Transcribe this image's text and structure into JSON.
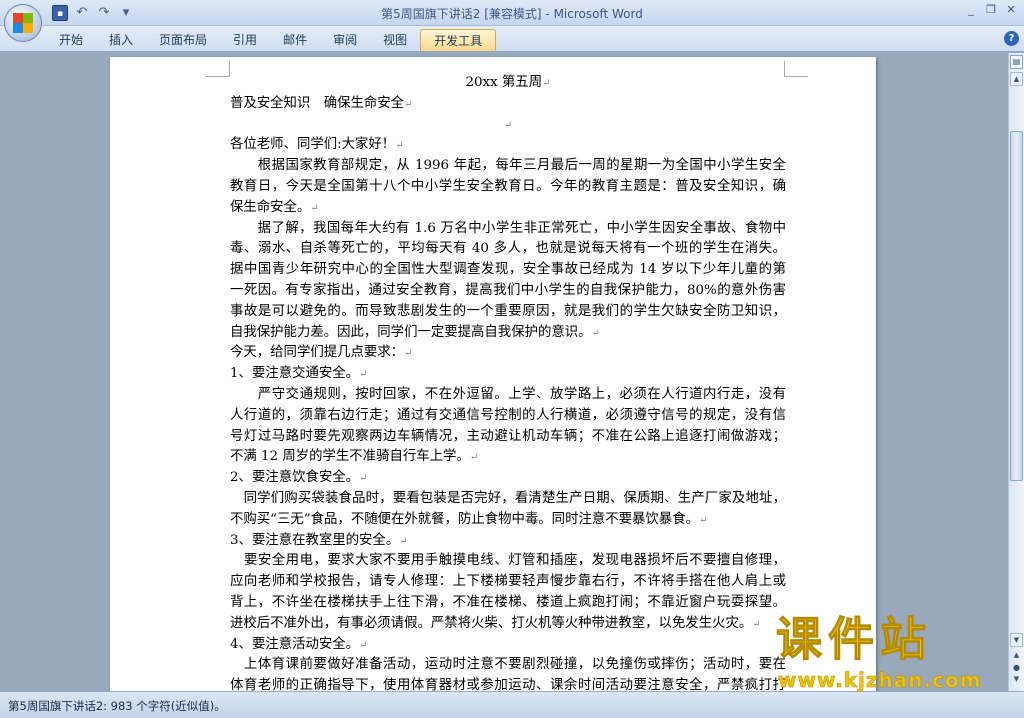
{
  "window": {
    "title": "第5周国旗下讲话2 [兼容模式]",
    "app_name": "Microsoft Word",
    "controls": [
      "_",
      "❐",
      "✕"
    ]
  },
  "qat": {
    "save": "▪",
    "undo": "↶",
    "redo": "↷",
    "more": "▾"
  },
  "ribbon": {
    "tabs": [
      {
        "label": "开始"
      },
      {
        "label": "插入"
      },
      {
        "label": "页面布局"
      },
      {
        "label": "引用"
      },
      {
        "label": "邮件"
      },
      {
        "label": "审阅"
      },
      {
        "label": "视图"
      },
      {
        "label": "开发工具"
      }
    ],
    "help": "?"
  },
  "document": {
    "lines": [
      {
        "text": "20xx 第五周",
        "align": "center"
      },
      {
        "text": "普及安全知识　确保生命安全",
        "align": "left"
      },
      {
        "text": "",
        "align": "center"
      },
      {
        "text": "各位老师、同学们:大家好！",
        "align": "left"
      },
      {
        "text": "　　根据国家教育部规定，从 1996 年起，每年三月最后一周的星期一为全国中小学生安全",
        "align": "just"
      },
      {
        "text": "教育日，今天是全国第十八个中小学生安全教育日。今年的教育主题是：普及安全知识，确",
        "align": "just"
      },
      {
        "text": "保生命安全。",
        "align": "left"
      },
      {
        "text": "　　据了解，我国每年大约有 1.6 万名中小学生非正常死亡，中小学生因安全事故、食物中",
        "align": "just"
      },
      {
        "text": "毒、溺水、自杀等死亡的，平均每天有 40 多人，也就是说每天将有一个班的学生在消失。",
        "align": "just"
      },
      {
        "text": "据中国青少年研究中心的全国性大型调查发现，安全事故已经成为 14 岁以下少年儿童的第",
        "align": "just"
      },
      {
        "text": "一死因。有专家指出，通过安全教育，提高我们中小学生的自我保护能力，80%的意外伤害",
        "align": "just"
      },
      {
        "text": "事故是可以避免的。而导致悲剧发生的一个重要原因，就是我们的学生欠缺安全防卫知识，",
        "align": "just"
      },
      {
        "text": "自我保护能力差。因此，同学们一定要提高自我保护的意识。",
        "align": "left"
      },
      {
        "text": "今天，给同学们提几点要求：",
        "align": "left"
      },
      {
        "text": "1、要注意交通安全。",
        "align": "left"
      },
      {
        "text": "　　严守交通规则，按时回家，不在外逗留。上学、放学路上，必须在人行道内行走，没有",
        "align": "just"
      },
      {
        "text": "人行道的，须靠右边行走；通过有交通信号控制的人行横道，必须遵守信号的规定，没有信",
        "align": "just"
      },
      {
        "text": "号灯过马路时要先观察两边车辆情况，主动避让机动车辆；不准在公路上追逐打闹做游戏；",
        "align": "just"
      },
      {
        "text": "不满 12 周岁的学生不准骑自行车上学。",
        "align": "left"
      },
      {
        "text": "2、要注意饮食安全。",
        "align": "left"
      },
      {
        "text": "　同学们购买袋装食品时，要看包装是否完好，看清楚生产日期、保质期、生产厂家及地址，",
        "align": "just"
      },
      {
        "text": "不购买“三无”食品，不随便在外就餐，防止食物中毒。同时注意不要暴饮暴食。",
        "align": "left"
      },
      {
        "text": "3、要注意在教室里的安全。",
        "align": "left"
      },
      {
        "text": "　要安全用电，要求大家不要用手触摸电线、灯管和插座，发现电器损坏后不要擅自修理，",
        "align": "just"
      },
      {
        "text": "应向老师和学校报告，请专人修理：上下楼梯要轻声慢步靠右行，不许将手搭在他人肩上或",
        "align": "just"
      },
      {
        "text": "背上，不许坐在楼梯扶手上往下滑，不准在楼梯、楼道上疯跑打闹；不靠近窗户玩耍探望。",
        "align": "just"
      },
      {
        "text": "进校后不准外出，有事必须请假。严禁将火柴、打火机等火种带进教室，以免发生火灾。",
        "align": "left"
      },
      {
        "text": "4、要注意活动安全。",
        "align": "left"
      },
      {
        "text": "　上体育课前要做好准备活动，运动时注意不要剧烈碰撞，以免撞伤或摔伤；活动时，要在",
        "align": "just"
      },
      {
        "text": "体育老师的正确指导下，使用体育器材或参加运动、课余时间活动要注意安全，严禁疯打打",
        "align": "just"
      }
    ],
    "para_mark": "↵"
  },
  "scrollbar": {
    "ruler": "▤",
    "up": "▲",
    "down": "▼",
    "prev": "▲",
    "browse": "●",
    "next": "▼"
  },
  "status": {
    "text": "第5周国旗下讲话2: 983 个字符(近似值)。"
  },
  "watermark": {
    "title": "课件站",
    "url": "www.kjzhan.com"
  },
  "colors": {
    "accent": "#1e395b",
    "watermark": "#f2c400"
  }
}
